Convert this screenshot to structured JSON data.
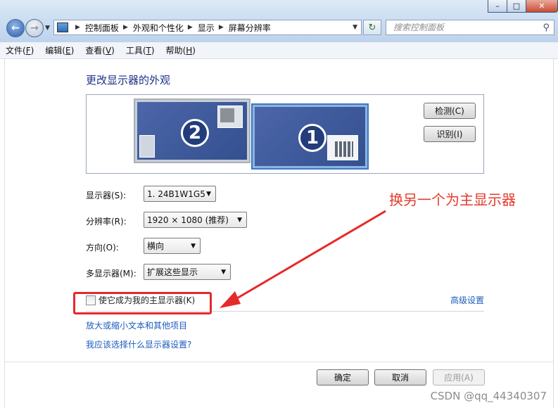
{
  "window": {
    "minimize": "–",
    "maximize": "□",
    "close": "✕"
  },
  "nav": {
    "breadcrumbs": [
      "控制面板",
      "外观和个性化",
      "显示",
      "屏幕分辨率"
    ],
    "search_placeholder": "搜索控制面板"
  },
  "menu": [
    {
      "text": "文件(",
      "key": "F",
      "end": ")"
    },
    {
      "text": "编辑(",
      "key": "E",
      "end": ")"
    },
    {
      "text": "查看(",
      "key": "V",
      "end": ")"
    },
    {
      "text": "工具(",
      "key": "T",
      "end": ")"
    },
    {
      "text": "帮助(",
      "key": "H",
      "end": ")"
    }
  ],
  "main": {
    "title": "更改显示器的外观",
    "monitor_numbers": [
      "2",
      "1"
    ],
    "detect": "检测(C)",
    "identify": "识别(I)",
    "display_label": "显示器(S):",
    "display_value": "1. 24B1W1G5",
    "resolution_label": "分辨率(R):",
    "resolution_value": "1920 × 1080 (推荐)",
    "orientation_label": "方向(O):",
    "orientation_value": "横向",
    "multi_label": "多显示器(M):",
    "multi_value": "扩展这些显示",
    "primary_checkbox": "使它成为我的主显示器(K)",
    "advanced_link": "高级设置",
    "link_text_size": "放大或缩小文本和其他项目",
    "link_which_settings": "我应该选择什么显示器设置?"
  },
  "buttons": {
    "ok": "确定",
    "cancel": "取消",
    "apply": "应用(A)"
  },
  "annotation": {
    "text": "换另一个为主显示器",
    "color": "#e43b2c"
  },
  "watermark": "CSDN @qq_44340307"
}
